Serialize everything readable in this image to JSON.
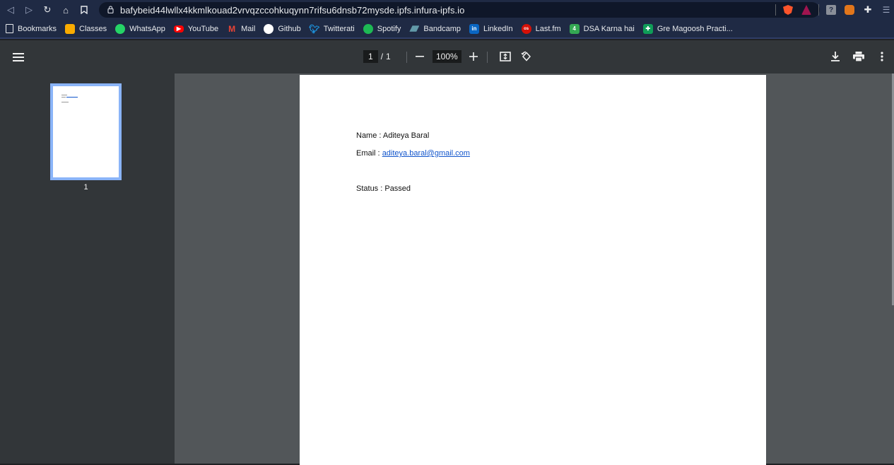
{
  "browser": {
    "url": "bafybeid44lwllx4kkmlkouad2vrvqzccohkuqynn7rifsu6dnsb72mysde.ipfs.infura-ipfs.io",
    "bookmarks_folder": "Bookmarks",
    "bookmarks": [
      {
        "label": "Classes",
        "icon": "classroom-icon",
        "color": "#f9ab00"
      },
      {
        "label": "WhatsApp",
        "icon": "whatsapp-icon",
        "color": "#25d366"
      },
      {
        "label": "YouTube",
        "icon": "youtube-icon",
        "color": "#ff0000"
      },
      {
        "label": "Mail",
        "icon": "gmail-icon",
        "color": "#ea4335"
      },
      {
        "label": "Github",
        "icon": "github-icon",
        "color": "#ffffff"
      },
      {
        "label": "Twitterati",
        "icon": "twitter-icon",
        "color": "#1da1f2"
      },
      {
        "label": "Spotify",
        "icon": "spotify-icon",
        "color": "#1db954"
      },
      {
        "label": "Bandcamp",
        "icon": "bandcamp-icon",
        "color": "#629aa9"
      },
      {
        "label": "LinkedIn",
        "icon": "linkedin-icon",
        "color": "#0a66c2"
      },
      {
        "label": "Last.fm",
        "icon": "lastfm-icon",
        "color": "#d51007"
      },
      {
        "label": "DSA Karna hai",
        "icon": "sheet-4-icon",
        "color": "#34a853"
      },
      {
        "label": "Gre Magoosh Practi...",
        "icon": "sheets-icon",
        "color": "#0f9d58"
      }
    ]
  },
  "viewer": {
    "current_page": "1",
    "page_separator": "/",
    "total_pages": "1",
    "zoom": "100%"
  },
  "sidebar": {
    "thumbnail_label": "1"
  },
  "document": {
    "name_line": "Name : Aditeya Baral",
    "email_prefix": "Email : ",
    "email": "aditeya.baral@gmail.com",
    "status_line": "Status : Passed"
  }
}
